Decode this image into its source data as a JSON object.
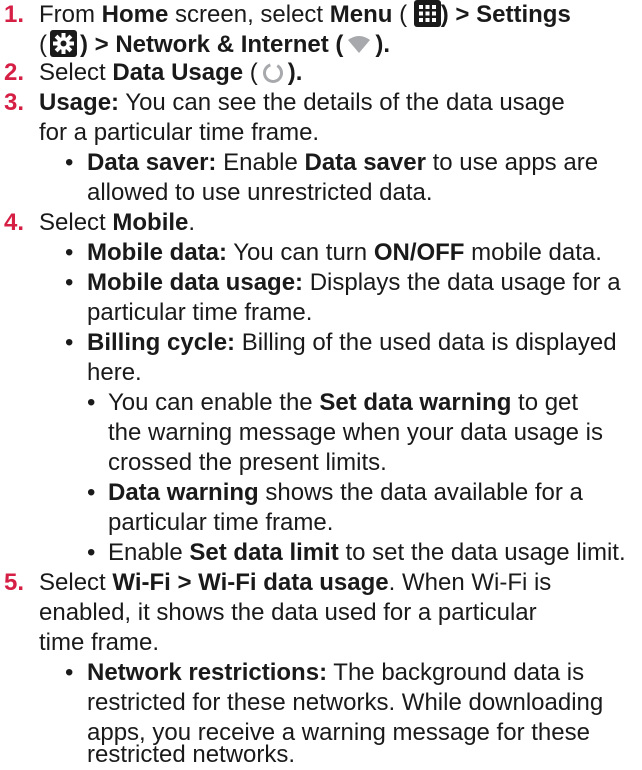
{
  "steps": [
    {
      "number": "1.",
      "l1": [
        "From ",
        "Home",
        " screen, select ",
        "Menu",
        " ( ",
        ") > Settings"
      ],
      "l2": [
        "(",
        ") > Network & Internet (",
        ")."
      ]
    },
    {
      "number": "2.",
      "l1": [
        "Select ",
        "Data Usage",
        " (",
        ")."
      ]
    },
    {
      "number": "3.",
      "l1": [
        "Usage:",
        " You can see the details of the data usage"
      ],
      "l2": "for a particular time frame.",
      "bullets": [
        {
          "b1": [
            "Data saver:",
            " Enable ",
            "Data saver",
            " to use apps are"
          ],
          "b2": "allowed to use unrestricted data."
        }
      ]
    },
    {
      "number": "4.",
      "l1": [
        "Select ",
        "Mobile",
        "."
      ],
      "bullets": [
        {
          "b1": [
            "Mobile data:",
            " You can turn ",
            "ON/OFF",
            " mobile data."
          ]
        },
        {
          "b1": [
            "Mobile data usage:",
            " Displays the data usage for a"
          ],
          "b2": "particular time frame."
        },
        {
          "b1": [
            "Billing cycle:",
            " Billing of the used data is displayed"
          ],
          "b2": "here."
        }
      ],
      "subbullets": [
        {
          "s1": [
            "You can enable the ",
            "Set data warning",
            " to get"
          ],
          "s2": "the warning message when your data usage is",
          "s3": "crossed the present limits."
        },
        {
          "s1": [
            "Data warning",
            " shows the data available for a"
          ],
          "s2": "particular time frame."
        },
        {
          "s1": [
            "Enable ",
            "Set data limit",
            " to set the data usage limit."
          ]
        }
      ]
    },
    {
      "number": "5.",
      "l1": [
        "Select ",
        "Wi-Fi > Wi-Fi data usage",
        ". When Wi-Fi is"
      ],
      "l2": "enabled, it shows the data used for a particular",
      "l3": "time frame.",
      "bullets": [
        {
          "b1": [
            "Network restrictions:",
            " The background data is"
          ],
          "b2": "restricted for these networks. While downloading",
          "b3": "apps, you receive a warning message for these",
          "b4": "restricted networks."
        }
      ]
    }
  ],
  "bullet_glyph": "•",
  "icons": {
    "menu": "grid-menu-icon",
    "settings": "gear-icon",
    "network": "wifi-icon",
    "data_usage": "data-usage-ring-icon"
  },
  "colors": {
    "number": "#d61f45",
    "text": "#1a1a1a",
    "icon_bg": "#1a1a1a"
  }
}
